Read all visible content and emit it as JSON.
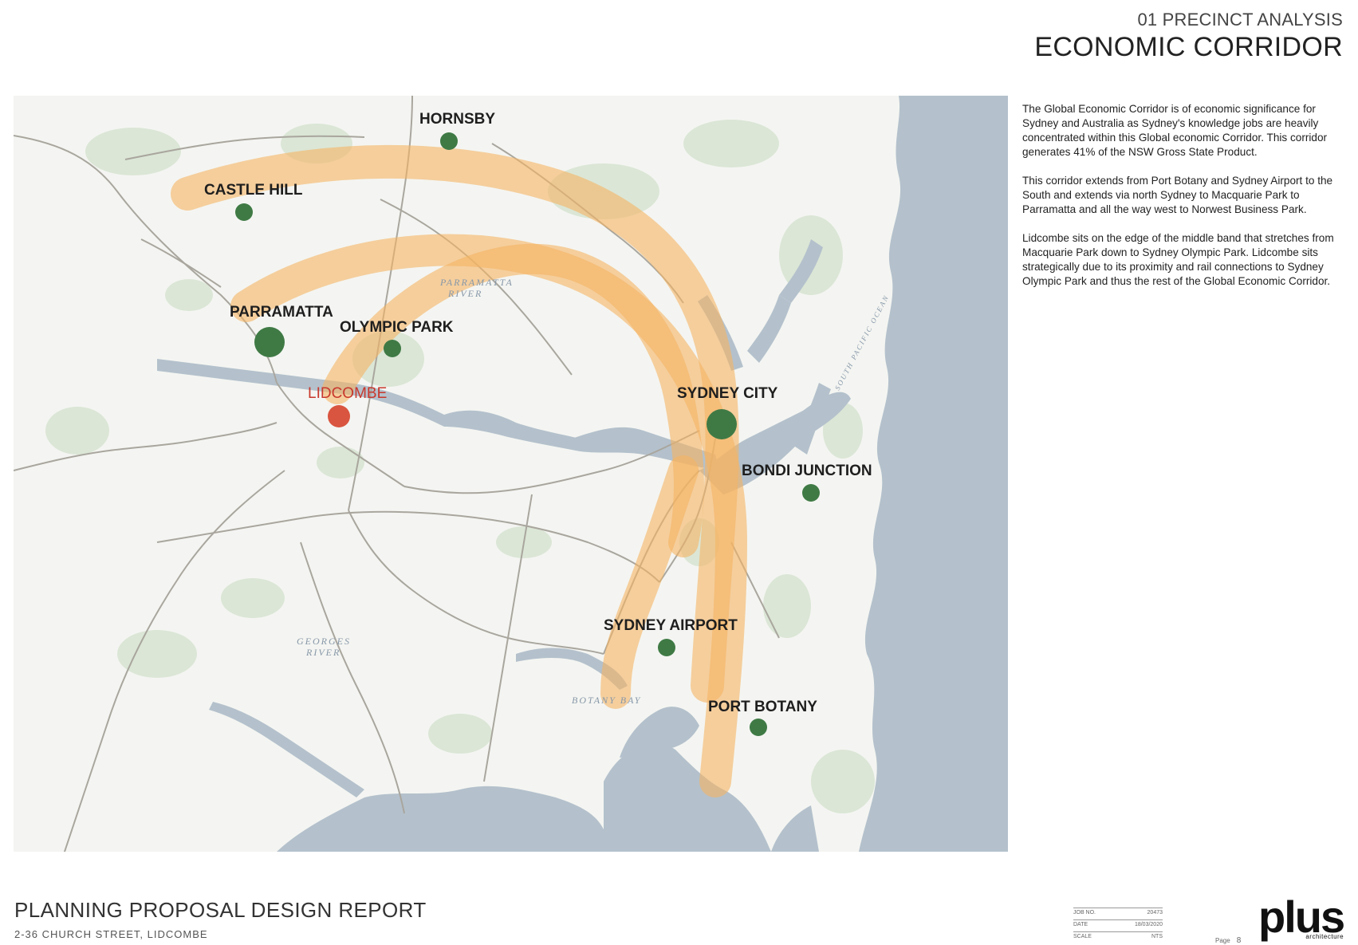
{
  "header": {
    "section": "01 PRECINCT ANALYSIS",
    "title": "ECONOMIC CORRIDOR"
  },
  "description": {
    "paragraphs": [
      "The Global Economic Corridor is of economic significance for Sydney and Australia as Sydney's knowledge jobs are heavily concentrated within this Global economic Corridor. This corridor generates 41% of the NSW Gross State Product.",
      "This corridor extends from Port Botany and Sydney Airport to the South and extends via north Sydney to Macquarie Park to Parramatta and all the way west to Norwest Business Park.",
      "Lidcombe sits on the edge of the middle band that stretches from Macquarie Park down to Sydney Olympic Park. Lidcombe sits strategically due to its proximity and rail connections to Sydney Olympic Park and thus the rest of the Global Economic Corridor."
    ]
  },
  "map": {
    "locations": {
      "hornsby": "HORNSBY",
      "castle_hill": "CASTLE HILL",
      "parramatta": "PARRAMATTA",
      "olympic_park": "OLYMPIC PARK",
      "lidcombe": "LIDCOMBE",
      "sydney_city": "SYDNEY CITY",
      "bondi_junction": "BONDI JUNCTION",
      "sydney_airport": "SYDNEY AIRPORT",
      "port_botany": "PORT BOTANY"
    },
    "water_labels": {
      "botany_bay": "BOTANY BAY",
      "georges_river": "GEORGES",
      "georges_river_2": "RIVER",
      "parramatta_river": "PARRAMATTA",
      "parramatta_river_2": "RIVER",
      "tasman": "SOUTH PACIFIC OCEAN"
    },
    "colors": {
      "corridor": "#f5b462",
      "node": "#3f7a45",
      "highlight_node": "#d9553f",
      "water": "#b4c1cc",
      "land": "#f4f5f2",
      "park": "#dbe6d6"
    }
  },
  "footer": {
    "title": "PLANNING PROPOSAL DESIGN REPORT",
    "subtitle": "2-36 CHURCH STREET, LIDCOMBE",
    "meta": [
      {
        "label": "JOB NO.",
        "value": "20473"
      },
      {
        "label": "DATE",
        "value": "18/03/2020"
      },
      {
        "label": "SCALE",
        "value": "NTS"
      }
    ],
    "page_label": "Page",
    "page_number": "8",
    "logo_word": "plus",
    "logo_sub": "architecture"
  }
}
